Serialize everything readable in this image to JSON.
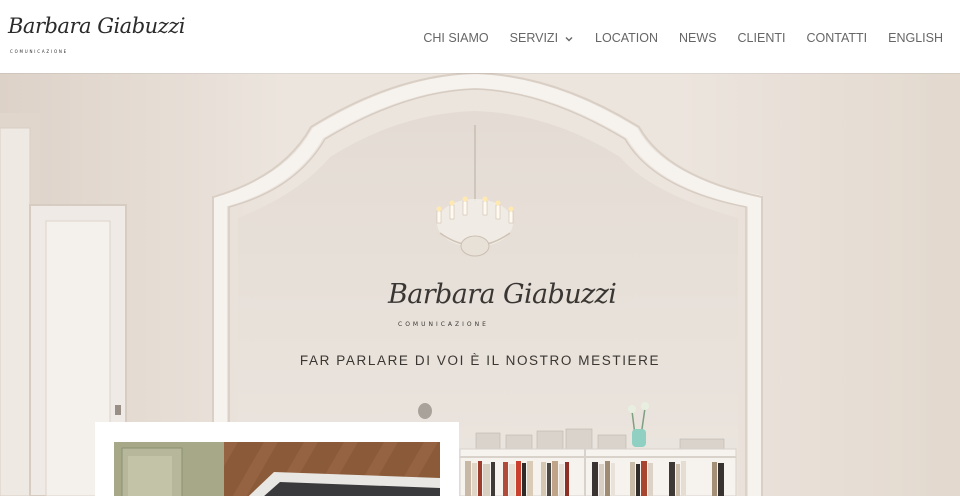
{
  "header": {
    "logo": {
      "script": "Barbara Giabuzzi",
      "subtitle": "COMUNICAZIONE"
    },
    "nav": [
      {
        "label": "CHI SIAMO",
        "has_dropdown": false
      },
      {
        "label": "SERVIZI",
        "has_dropdown": true,
        "icon": "chevron-down-icon"
      },
      {
        "label": "LOCATION",
        "has_dropdown": false
      },
      {
        "label": "NEWS",
        "has_dropdown": false
      },
      {
        "label": "CLIENTI",
        "has_dropdown": false
      },
      {
        "label": "CONTATTI",
        "has_dropdown": false
      },
      {
        "label": "ENGLISH",
        "has_dropdown": false
      }
    ]
  },
  "hero": {
    "logo": {
      "script": "Barbara Giabuzzi",
      "subtitle": "COMUNICAZIONE"
    },
    "tagline": "FAR PARLARE DI VOI È IL NOSTRO MESTIERE"
  },
  "colors": {
    "nav_text": "#666666",
    "wall": "#e9e1d9",
    "arch_trim": "#f3eee9",
    "tagline": "#3b3632"
  }
}
